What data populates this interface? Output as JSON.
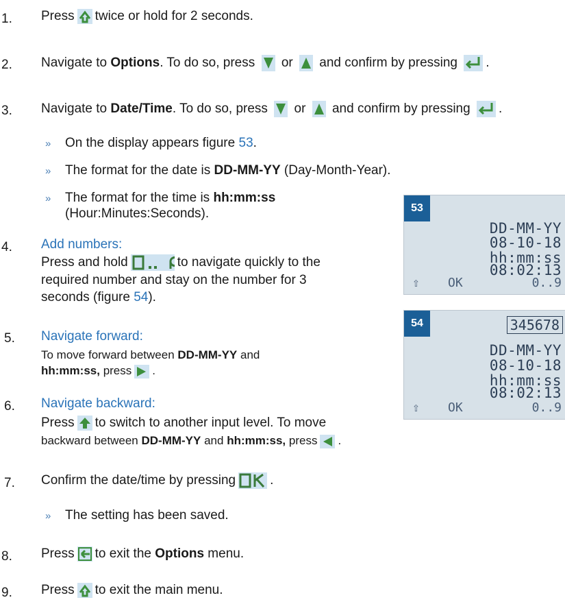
{
  "steps": {
    "s1": {
      "num": "1.",
      "a": "Press",
      "b": "twice or hold for 2 seconds."
    },
    "s2": {
      "num": "2.",
      "a": "Navigate to ",
      "b": "Options",
      "c": ". To do so, press",
      "d": "or",
      "e": "and confirm by pressing",
      "f": "."
    },
    "s3": {
      "num": "3.",
      "a": "Navigate to ",
      "b": "Date/Time",
      "c": ". To do so, press",
      "d": "or",
      "e": "and confirm by pressing",
      "f": "."
    },
    "s4": {
      "num": "4.",
      "heading": "Add numbers:",
      "l1a": "Press and hold",
      "l1b": "to navigate quickly to the",
      "l2": "required number and stay on the number for 3",
      "l3a": "seconds  (figure ",
      "l3b": "54",
      "l3c": ")."
    },
    "s5": {
      "num": "5.",
      "heading": "Navigate forward:",
      "l1": "To move forward between ",
      "l1b": "DD-MM-YY",
      "l1c": " and",
      "l2a": "hh:mm:ss,",
      "l2b": " press",
      "l2c": "."
    },
    "s6": {
      "num": "6.",
      "heading": "Navigate backward:",
      "l1a": "Press",
      "l1b": "to switch to another input level. To move",
      "l2a": "backward between ",
      "l2b": "DD-MM-YY",
      "l2c": " and ",
      "l2d": "hh:mm:ss,",
      "l2e": " press",
      "l2f": "."
    },
    "s7": {
      "num": "7.",
      "a": "Confirm the date/time by pressing",
      "b": "."
    },
    "s8": {
      "num": "8.",
      "a": "Press",
      "b": "to exit the ",
      "c": "Options",
      "d": " menu."
    },
    "s9": {
      "num": "9.",
      "a": "Press",
      "b": "to exit the main menu."
    }
  },
  "bullets": {
    "marker": "»",
    "b1a": "On the display appears figure ",
    "b1b": "53",
    "b1c": ".",
    "b2a": "The format for the date is ",
    "b2b": "DD-MM-YY",
    "b2c": " (Day-Month-Year).",
    "b3a": "The format for the time is ",
    "b3b": "hh:mm:ss",
    "b3c": "(Hour:Minutes:Seconds).",
    "b4": "The setting has been saved."
  },
  "fig53": {
    "tag": "53",
    "line1": "DD-MM-YY",
    "line2": "08-10-18",
    "line3": "hh:mm:ss",
    "line4": "08:02:13",
    "up": "⇧",
    "ok": "OK",
    "range": "0..9"
  },
  "fig54": {
    "tag": "54",
    "boxed": "345678",
    "line1": "DD-MM-YY",
    "line2": "08-10-18",
    "line3": "hh:mm:ss",
    "line4": "08:02:13",
    "up": "⇧",
    "ok": "OK",
    "range": "0..9"
  },
  "colors": {
    "accent": "#2a73b8",
    "tag": "#1b5f97",
    "lcd": "#d7e1e8",
    "icon": "#cfe3f1"
  }
}
